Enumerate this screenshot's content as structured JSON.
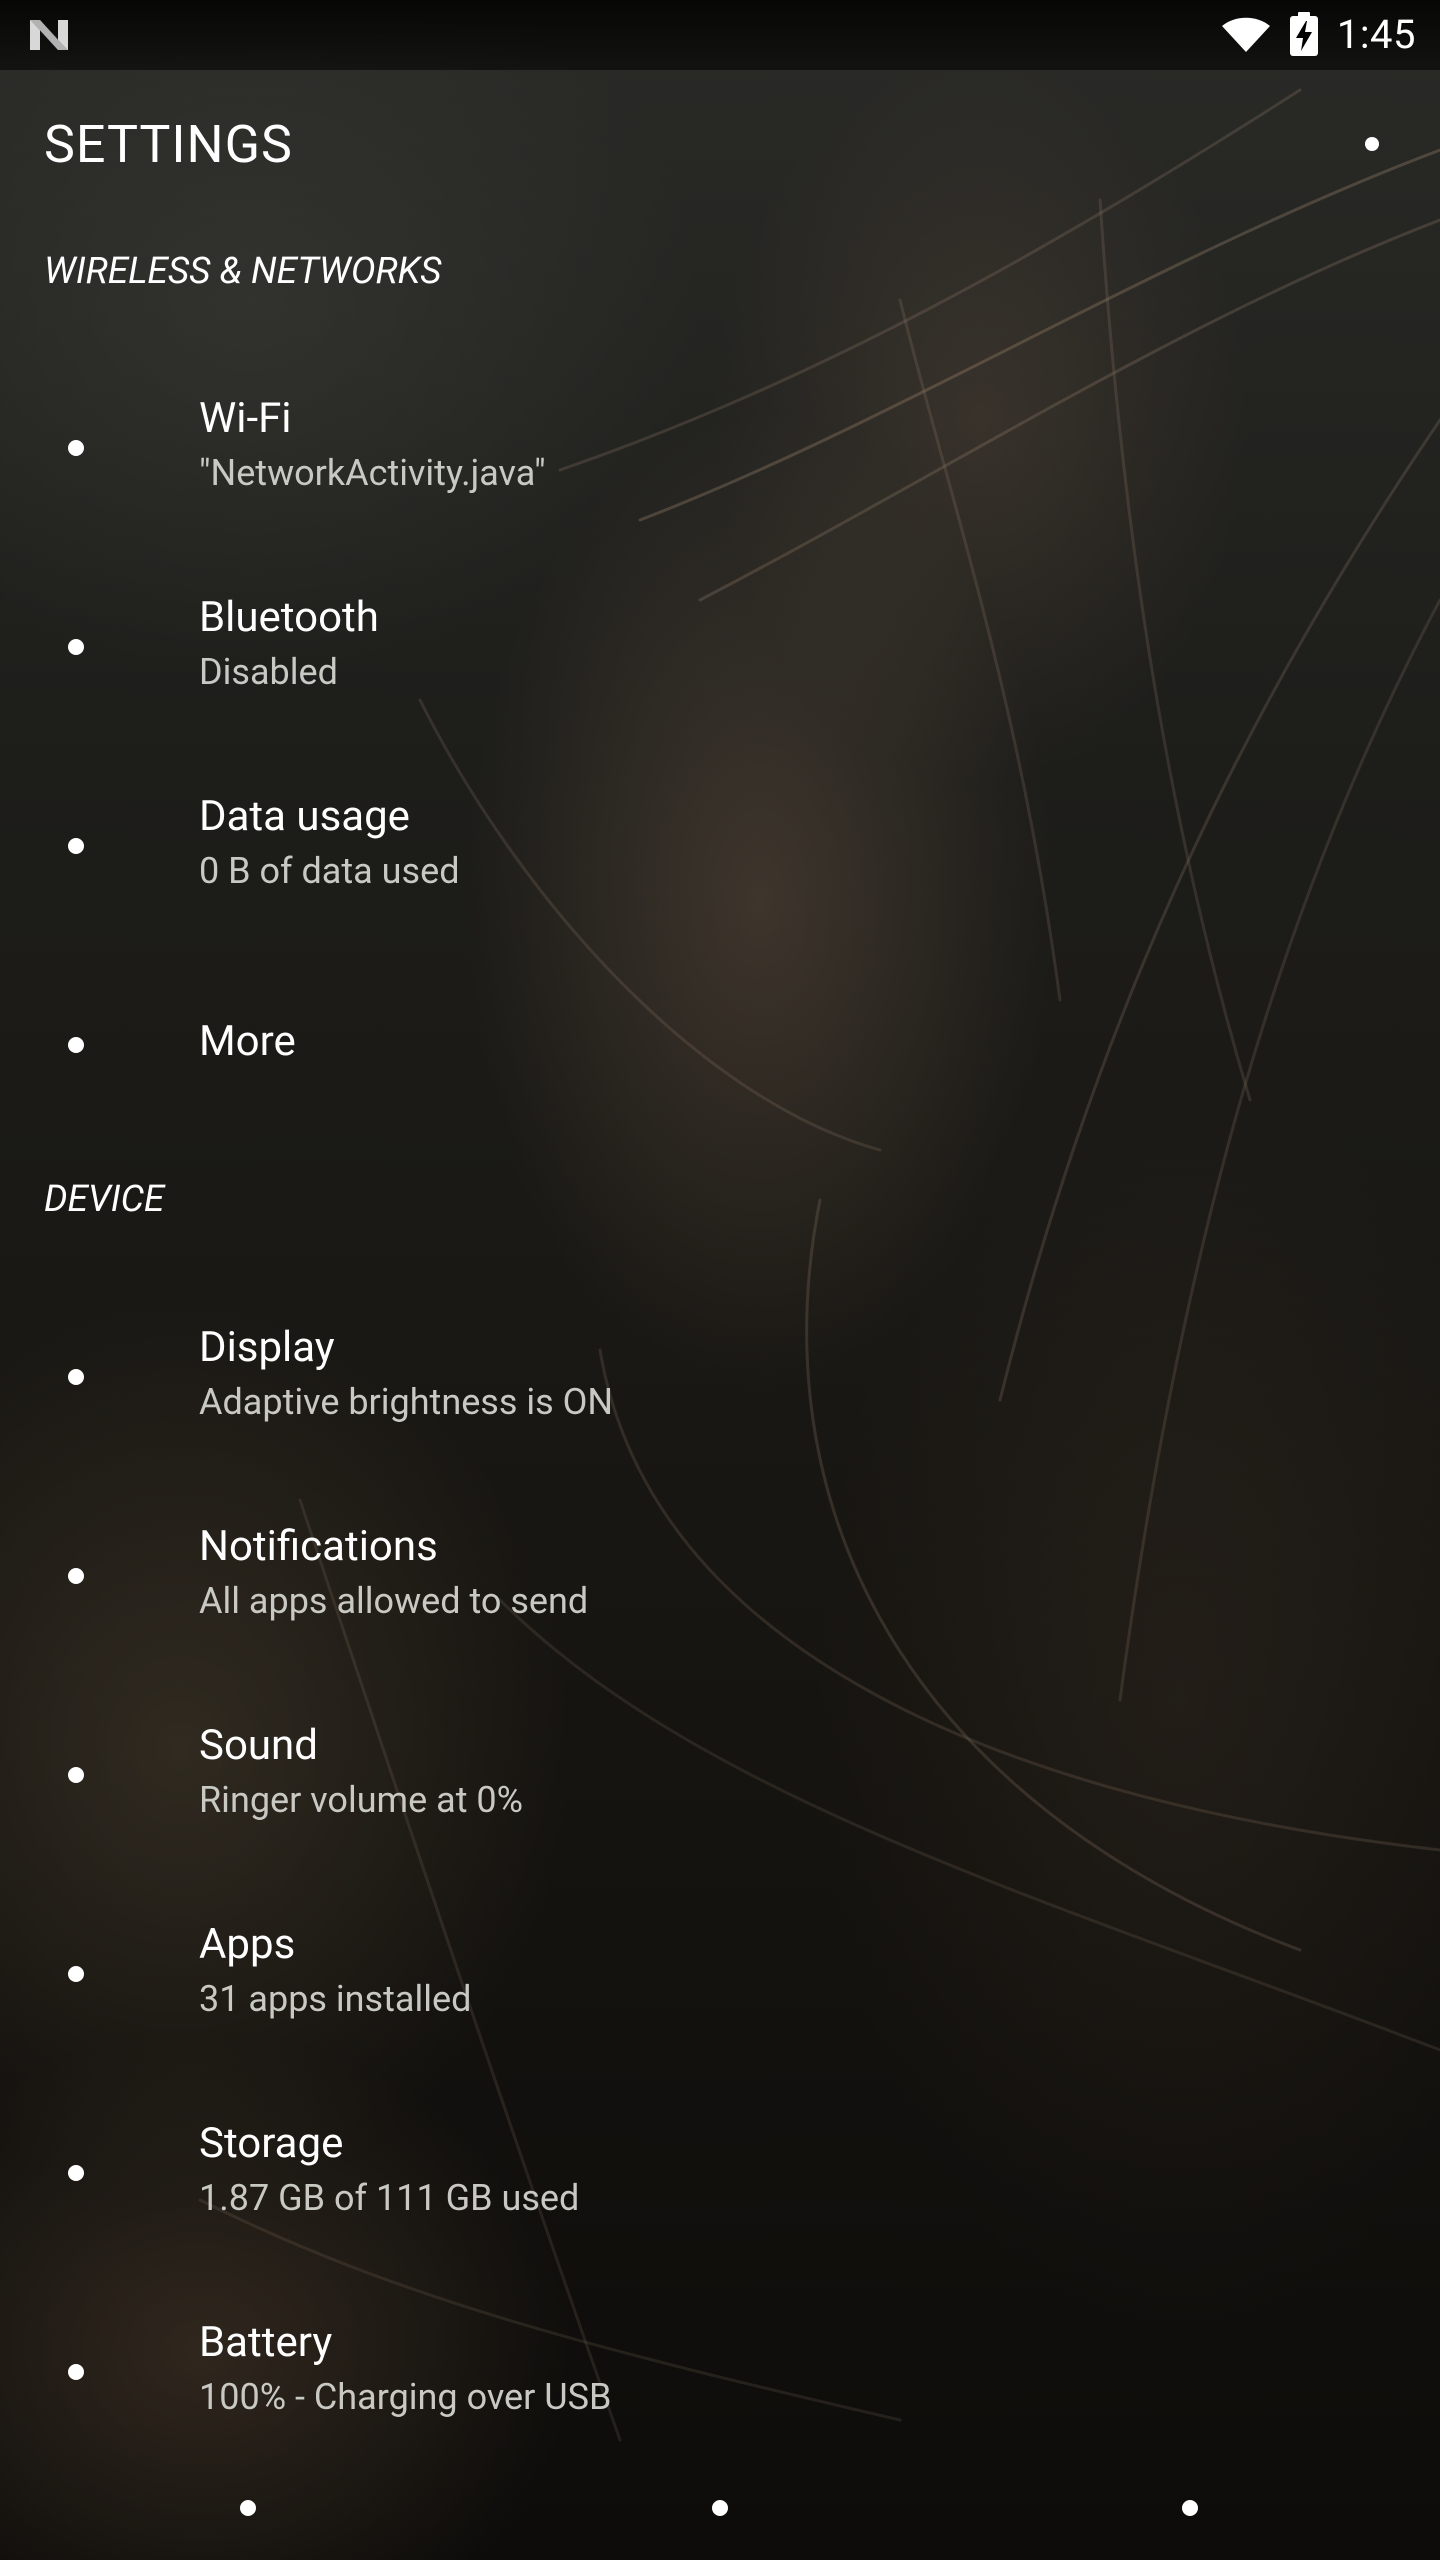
{
  "status_bar": {
    "time": "1:45",
    "icons": [
      "n-logo-icon",
      "wifi-icon",
      "battery-charging-icon"
    ]
  },
  "toolbar": {
    "title": "SETTINGS",
    "overflow_icon": "more-vert-icon"
  },
  "sections": [
    {
      "header": "WIRELESS & NETWORKS",
      "items": [
        {
          "title": "Wi-Fi",
          "summary": "\"NetworkActivity.java\"",
          "icon": "wifi-icon"
        },
        {
          "title": "Bluetooth",
          "summary": "Disabled",
          "icon": "bluetooth-icon"
        },
        {
          "title": "Data usage",
          "summary": "0 B of data used",
          "icon": "data-usage-icon"
        },
        {
          "title": "More",
          "summary": "",
          "icon": "more-icon"
        }
      ]
    },
    {
      "header": "DEVICE",
      "items": [
        {
          "title": "Display",
          "summary": "Adaptive brightness is ON",
          "icon": "display-icon"
        },
        {
          "title": "Notifications",
          "summary": "All apps allowed to send",
          "icon": "notifications-icon"
        },
        {
          "title": "Sound",
          "summary": "Ringer volume at 0%",
          "icon": "sound-icon"
        },
        {
          "title": "Apps",
          "summary": "31 apps installed",
          "icon": "apps-icon"
        },
        {
          "title": "Storage",
          "summary": "1.87 GB of 111 GB used",
          "icon": "storage-icon"
        },
        {
          "title": "Battery",
          "summary": "100% - Charging over USB",
          "icon": "battery-icon"
        }
      ]
    }
  ],
  "nav_bar": {
    "buttons": [
      "back-icon",
      "home-icon",
      "recents-icon"
    ]
  }
}
